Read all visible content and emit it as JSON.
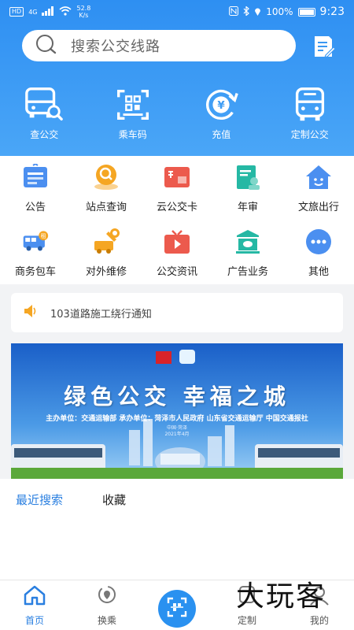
{
  "status_bar": {
    "hd": "HD",
    "network": "4G",
    "speed_value": "52.8",
    "speed_unit": "K/s",
    "battery": "100%",
    "time": "9:23"
  },
  "search": {
    "placeholder": "搜索公交线路",
    "icon": "search-icon",
    "edit_icon": "edit-note-icon"
  },
  "quick_actions": [
    {
      "label": "查公交",
      "icon": "bus-search-icon"
    },
    {
      "label": "乘车码",
      "icon": "ride-code-icon"
    },
    {
      "label": "充值",
      "icon": "recharge-yuan-icon"
    },
    {
      "label": "定制公交",
      "icon": "custom-bus-icon"
    }
  ],
  "services": [
    {
      "label": "公告",
      "icon": "announcement-icon",
      "color": "#4b8ff0"
    },
    {
      "label": "站点查询",
      "icon": "station-query-icon",
      "color": "#f5a623"
    },
    {
      "label": "云公交卡",
      "icon": "cloud-card-icon",
      "color": "#ec5a4d"
    },
    {
      "label": "年审",
      "icon": "annual-review-icon",
      "color": "#25b8a4"
    },
    {
      "label": "文旅出行",
      "icon": "tourism-home-icon",
      "color": "#4b8ff0"
    },
    {
      "label": "商务包车",
      "icon": "charter-bus-icon",
      "color": "#4b8ff0"
    },
    {
      "label": "对外维修",
      "icon": "repair-icon",
      "color": "#f5a623"
    },
    {
      "label": "公交资讯",
      "icon": "tv-news-icon",
      "color": "#ec5a4d"
    },
    {
      "label": "广告业务",
      "icon": "advertising-icon",
      "color": "#25b8a4"
    },
    {
      "label": "其他",
      "icon": "more-dots-icon",
      "color": "#4b8ff0"
    }
  ],
  "notice": {
    "icon": "speaker-icon",
    "text": "103道路施工绕行通知"
  },
  "banner": {
    "title": "绿色公交  幸福之城",
    "subtitle": "主办单位：交通运输部  承办单位：菏泽市人民政府  山东省交通运输厅  中国交通报社",
    "date_line1": "中国·菏泽",
    "date_line2": "2021年4月"
  },
  "tabs": {
    "recent": "最近搜索",
    "favorites": "收藏"
  },
  "bottom_nav": {
    "home": "首页",
    "transfer": "换乘",
    "custom": "定制",
    "mine": "我的"
  },
  "watermark": "大玩客",
  "colors": {
    "brand_blue": "#2e8ff2",
    "active_blue": "#2a7fe0",
    "scan_blue": "#2a91f0"
  }
}
